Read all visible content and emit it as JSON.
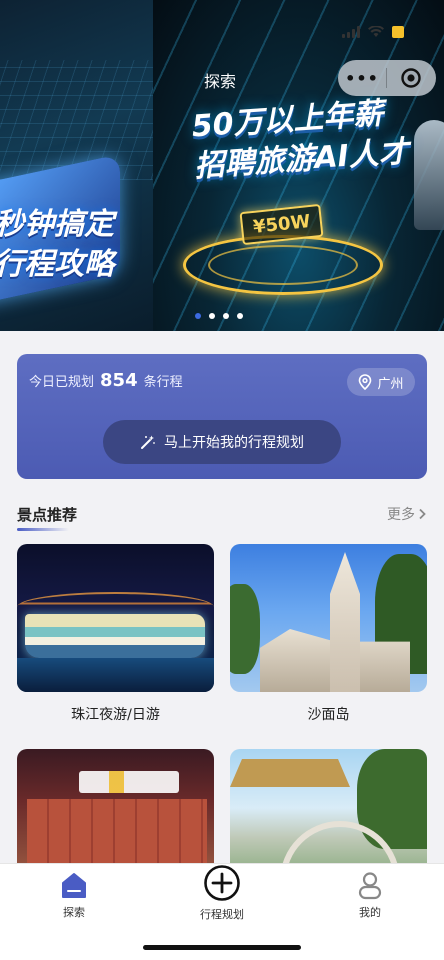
{
  "header": {
    "title": "探索",
    "capsule_more": "•••"
  },
  "banner": {
    "left_slide_text": [
      "秒钟搞定",
      "行程攻略"
    ],
    "right_slide_text": [
      "50万以上年薪",
      "招聘旅游AI人才"
    ],
    "right_slide_tag": "¥50W",
    "page_count": 4,
    "active_index": 0
  },
  "plan_card": {
    "prefix": "今日已规划",
    "count": "854",
    "suffix": "条行程",
    "city": "广州",
    "start_button": "马上开始我的行程规划"
  },
  "section": {
    "title": "景点推荐",
    "more": "更多"
  },
  "spots": [
    {
      "name": "珠江夜游/日游"
    },
    {
      "name": "沙面岛"
    },
    {
      "name": ""
    },
    {
      "name": ""
    }
  ],
  "tabbar": {
    "items": [
      {
        "label": "探索",
        "icon": "home-icon",
        "active": true
      },
      {
        "label": "行程规划",
        "icon": "plus-circle-icon",
        "active": false
      },
      {
        "label": "我的",
        "icon": "user-icon",
        "active": false
      }
    ]
  },
  "colors": {
    "plan_card_bg": "#5563b8",
    "start_button_bg": "#3b4683",
    "tab_active": "#4a5cc4",
    "accent_dot": "#3c6ae0",
    "battery": "#f6c12b"
  }
}
